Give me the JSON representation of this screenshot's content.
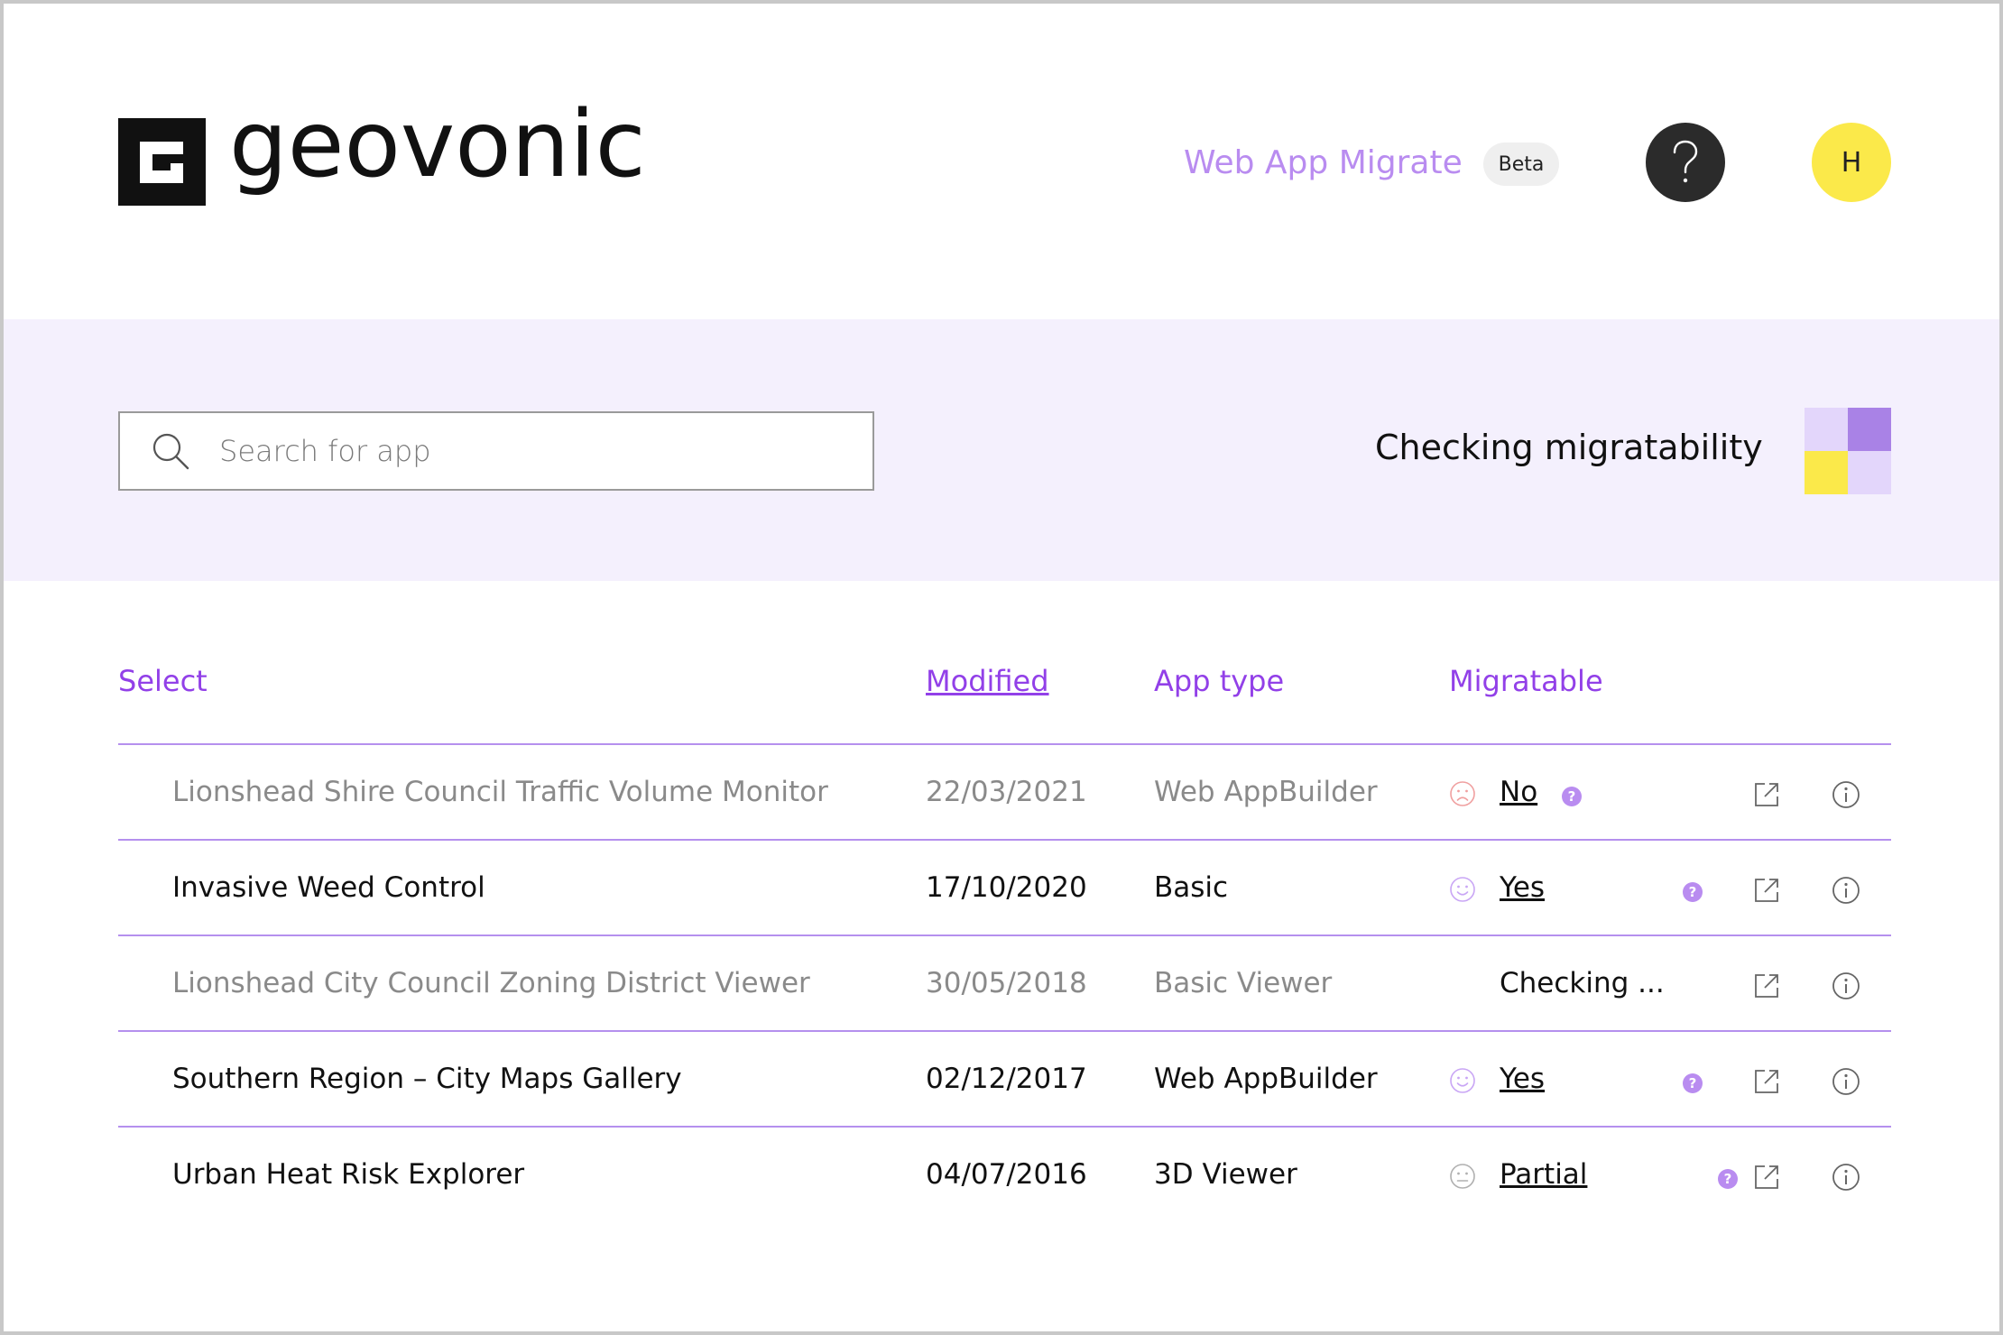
{
  "header": {
    "brand": "geovonic",
    "nav_link": "Web App Migrate",
    "badge": "Beta",
    "help_glyph": "?",
    "avatar_initial": "H",
    "colors": {
      "accent": "#9240e8",
      "nav": "#b98cf0",
      "avatar": "#fbe94a"
    }
  },
  "search": {
    "placeholder": "Search for app",
    "value": ""
  },
  "status": {
    "text": "Checking migratability",
    "loader_colors": [
      "#e3d6fb",
      "#a982e6",
      "#fbe94a",
      "#e3d6fb"
    ]
  },
  "table": {
    "headers": {
      "select": "Select",
      "modified": "Modified",
      "app_type": "App type",
      "migratable": "Migratable"
    },
    "rows": [
      {
        "name": "Lionshead Shire Council Traffic Volume Monitor",
        "modified": "22/03/2021",
        "type": "Web AppBuilder",
        "migratable": "No",
        "face": "sad-face-icon",
        "dim": true
      },
      {
        "name": "Invasive Weed Control",
        "modified": "17/10/2020",
        "type": "Basic",
        "migratable": "Yes",
        "face": "happy-face-icon",
        "dim": false
      },
      {
        "name": "Lionshead City Council Zoning District Viewer",
        "modified": "30/05/2018",
        "type": "Basic Viewer",
        "migratable": "Checking ...",
        "face": "",
        "dim": true
      },
      {
        "name": "Southern Region – City Maps Gallery",
        "modified": "02/12/2017",
        "type": "Web AppBuilder",
        "migratable": "Yes",
        "face": "happy-face-icon",
        "dim": false
      },
      {
        "name": "Urban Heat Risk Explorer",
        "modified": "04/07/2016",
        "type": "3D Viewer",
        "migratable": "Partial",
        "face": "neutral-face-icon",
        "dim": false
      }
    ]
  }
}
